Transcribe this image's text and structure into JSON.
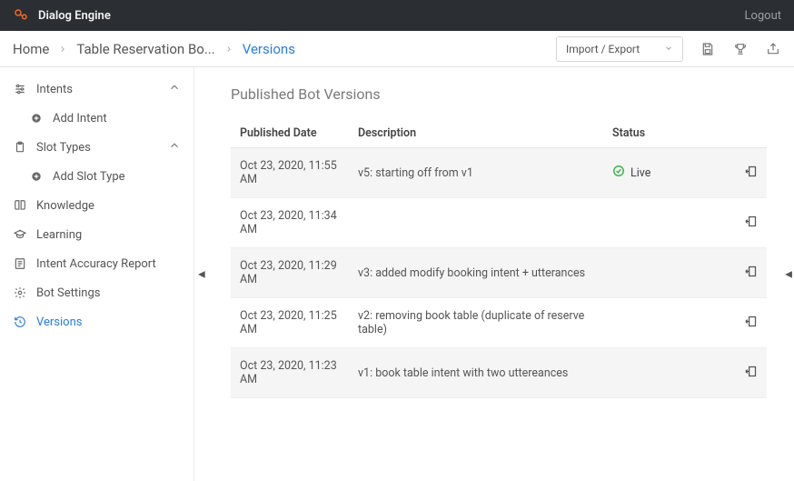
{
  "header": {
    "app_name": "Dialog Engine",
    "logout": "Logout"
  },
  "breadcrumb": {
    "home": "Home",
    "bot": "Table Reservation Bo...",
    "current": "Versions"
  },
  "toolbar": {
    "import_export": "Import / Export"
  },
  "sidebar": {
    "intents": "Intents",
    "add_intent": "Add Intent",
    "slot_types": "Slot Types",
    "add_slot_type": "Add Slot Type",
    "knowledge": "Knowledge",
    "learning": "Learning",
    "intent_accuracy": "Intent Accuracy Report",
    "bot_settings": "Bot Settings",
    "versions": "Versions"
  },
  "content": {
    "title": "Published Bot Versions",
    "columns": {
      "date": "Published Date",
      "desc": "Description",
      "status": "Status"
    },
    "rows": [
      {
        "date": "Oct 23, 2020, 11:55 AM",
        "desc": "v5: starting off from v1",
        "status": "Live"
      },
      {
        "date": "Oct 23, 2020, 11:34 AM",
        "desc": "",
        "status": ""
      },
      {
        "date": "Oct 23, 2020, 11:29 AM",
        "desc": "v3: added modify booking intent + utterances",
        "status": ""
      },
      {
        "date": "Oct 23, 2020, 11:25 AM",
        "desc": "v2: removing book table (duplicate of reserve table)",
        "status": ""
      },
      {
        "date": "Oct 23, 2020, 11:23 AM",
        "desc": "v1: book table intent with two uttereances",
        "status": ""
      }
    ]
  }
}
